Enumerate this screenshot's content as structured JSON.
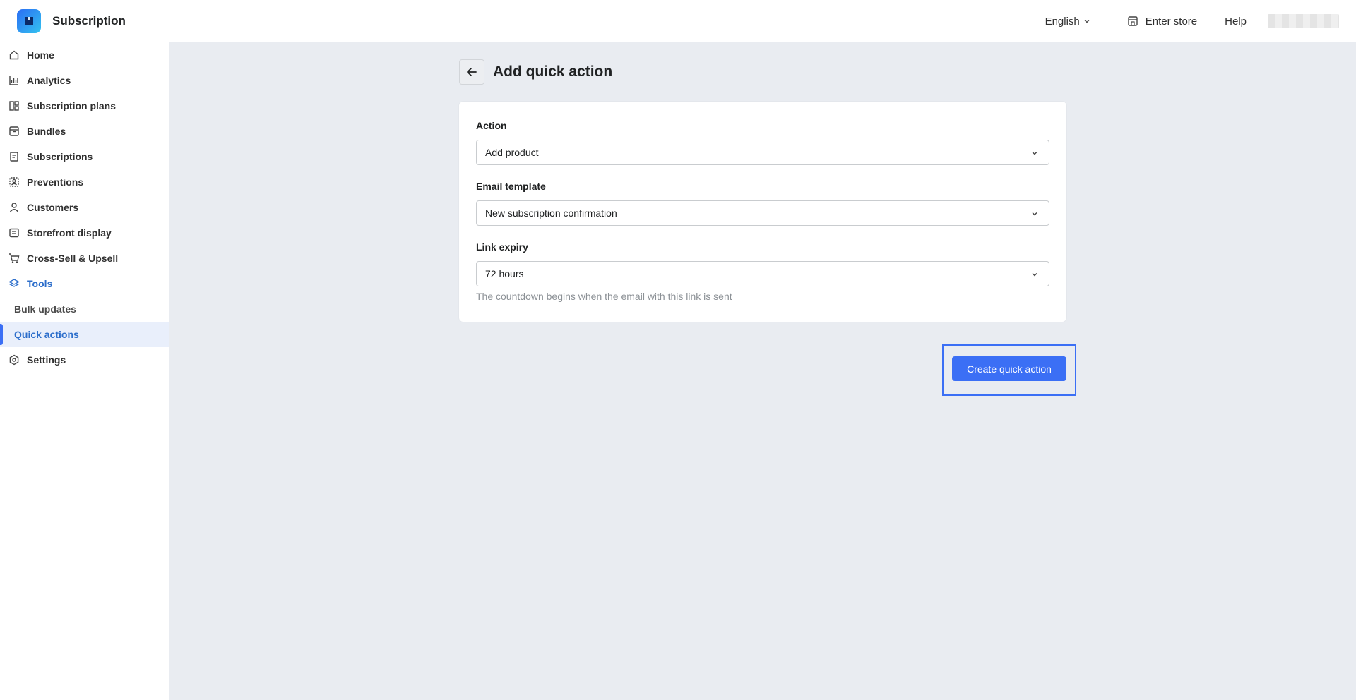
{
  "app": {
    "name": "Subscription"
  },
  "topbar": {
    "language": "English",
    "enter_store": "Enter store",
    "help": "Help"
  },
  "sidebar": {
    "items": [
      {
        "label": "Home",
        "icon": "home-icon"
      },
      {
        "label": "Analytics",
        "icon": "analytics-icon"
      },
      {
        "label": "Subscription plans",
        "icon": "plans-icon"
      },
      {
        "label": "Bundles",
        "icon": "bundles-icon"
      },
      {
        "label": "Subscriptions",
        "icon": "subscriptions-icon"
      },
      {
        "label": "Preventions",
        "icon": "preventions-icon"
      },
      {
        "label": "Customers",
        "icon": "customer-icon"
      },
      {
        "label": "Storefront display",
        "icon": "storefront-icon"
      },
      {
        "label": "Cross-Sell & Upsell",
        "icon": "cart-icon"
      },
      {
        "label": "Tools",
        "icon": "layers-icon"
      },
      {
        "label": "Settings",
        "icon": "settings-icon"
      }
    ],
    "tools_sub": [
      {
        "label": "Bulk updates"
      },
      {
        "label": "Quick actions"
      }
    ],
    "active_item": "Quick actions",
    "accent_color": "#2c6ecb"
  },
  "page": {
    "title": "Add quick action",
    "form": {
      "action_label": "Action",
      "action_value": "Add product",
      "email_label": "Email template",
      "email_value": "New subscription confirmation",
      "expiry_label": "Link expiry",
      "expiry_value": "72 hours",
      "expiry_help": "The countdown begins when the email with this link is sent"
    },
    "submit_label": "Create quick action",
    "primary_color": "#3b6ff5"
  }
}
